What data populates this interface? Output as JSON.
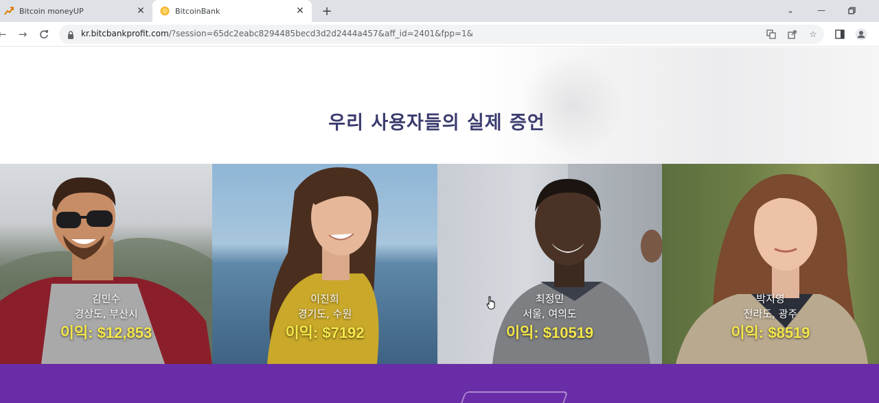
{
  "browser": {
    "tabs": [
      {
        "title": "Bitcoin moneyUP",
        "active": false,
        "favicon": "chart-up-icon"
      },
      {
        "title": "BitcoinBank",
        "active": true,
        "favicon": "bitcoin-coin-icon"
      }
    ],
    "url_host": "kr.bitcbankprofit.com",
    "url_rest": "/?session=65dc2eabc8294485becd3d2d2444a457&aff_id=2401&fpp=1&"
  },
  "page": {
    "section_title": "우리 사용자들의 실제 증언",
    "testimonials": [
      {
        "name": "김민수",
        "location": "경상도, 부산시",
        "profit": "이익: $12,853"
      },
      {
        "name": "이진희",
        "location": "경기도, 수원",
        "profit": "이익: $7192"
      },
      {
        "name": "최정민",
        "location": "서울, 여의도",
        "profit": "이익: $10519"
      },
      {
        "name": "박지영",
        "location": "전라도, 광주",
        "profit": "이익: $8519"
      }
    ]
  },
  "colors": {
    "title": "#3b3c6e",
    "profit": "#f4e64a",
    "band": "#6a2da8"
  }
}
